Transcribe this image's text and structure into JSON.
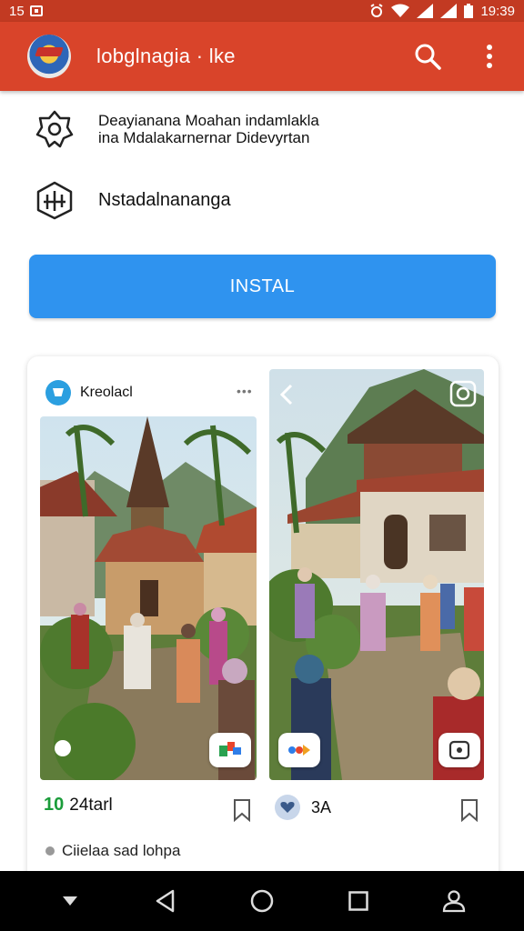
{
  "status_bar": {
    "left_text": "15",
    "time": "19:39"
  },
  "app_bar": {
    "title": "lobglnagia · lke",
    "logo_icon": "app-logo",
    "search_icon": "search-icon",
    "more_icon": "more-vert-icon"
  },
  "info": {
    "row1_line1": "Deayianana Moahan indamlakla",
    "row1_line2": "ina Mdalakarnernar Didevyrtan",
    "row1_icon": "badge-gear-icon",
    "row2_text": "Nstadalnananga",
    "row2_icon": "building-icon"
  },
  "install_button": {
    "label": "INSTAL",
    "color": "#2f93ef"
  },
  "card": {
    "name": "Kreolacl",
    "more": "•••",
    "likes_icon_text": "10",
    "likes": "24tarl",
    "likes2": "3A",
    "caption": "Ciielaa sad lohpa"
  },
  "colors": {
    "appbar": "#d9442a",
    "statusbar": "#c23a22",
    "accent": "#2f93ef"
  }
}
